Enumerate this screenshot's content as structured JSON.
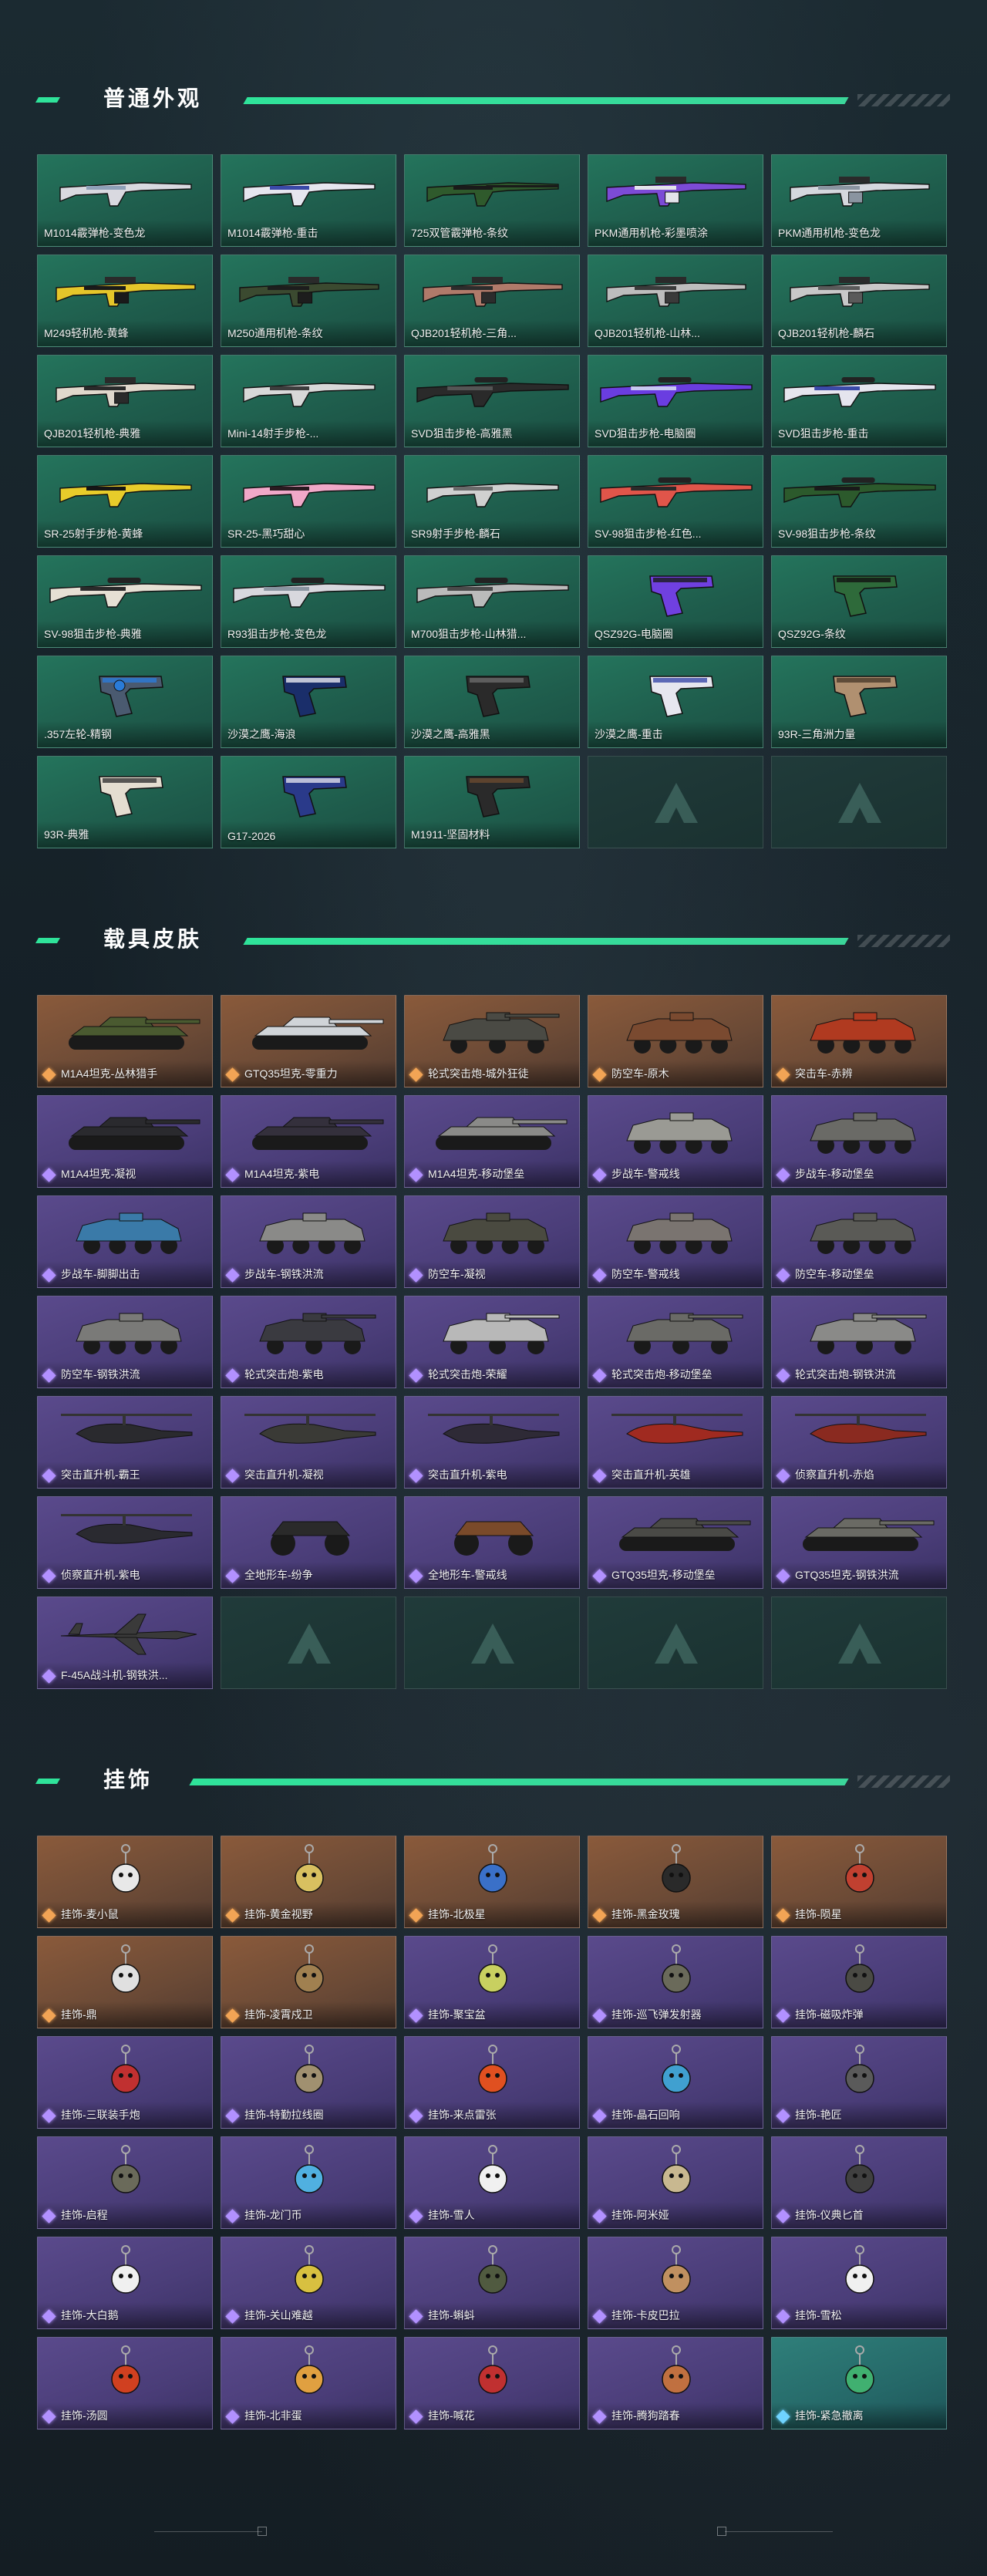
{
  "sections": [
    {
      "title": "普通外观"
    },
    {
      "title": "载具皮肤"
    },
    {
      "title": "挂饰"
    }
  ],
  "weapons": [
    {
      "label": "M1014霰弹枪-变色龙",
      "kind": "shotgun",
      "color": "#d9d9e0",
      "accent": "#8fa0b8"
    },
    {
      "label": "M1014霰弹枪-重击",
      "kind": "shotgun",
      "color": "#e6e6ef",
      "accent": "#3a49a8"
    },
    {
      "label": "725双管霰弹枪-条纹",
      "kind": "double",
      "color": "#2f5a2c",
      "accent": "#1a1a1a"
    },
    {
      "label": "PKM通用机枪-彩墨喷涂",
      "kind": "mg",
      "color": "#7c4bd6",
      "accent": "#e3e3ea"
    },
    {
      "label": "PKM通用机枪-变色龙",
      "kind": "mg",
      "color": "#d5d8de",
      "accent": "#8a94a0"
    },
    {
      "label": "M249轻机枪-黄蜂",
      "kind": "mg",
      "color": "#e5c62a",
      "accent": "#1a1a1a"
    },
    {
      "label": "M250通用机枪-条纹",
      "kind": "mg",
      "color": "#3b4a30",
      "accent": "#1d1d1d"
    },
    {
      "label": "QJB201轻机枪-三角...",
      "kind": "mg",
      "color": "#b07a6a",
      "accent": "#2c2c2c"
    },
    {
      "label": "QJB201轻机枪-山林...",
      "kind": "mg",
      "color": "#bdbdbd",
      "accent": "#3a3a3a"
    },
    {
      "label": "QJB201轻机枪-麟石",
      "kind": "mg",
      "color": "#c8c8c8",
      "accent": "#5a5a5a"
    },
    {
      "label": "QJB201轻机枪-典雅",
      "kind": "mg",
      "color": "#e0d8cc",
      "accent": "#2a2a2a"
    },
    {
      "label": "Mini-14射手步枪-...",
      "kind": "rifle",
      "color": "#d8d8d8",
      "accent": "#3d3d3d"
    },
    {
      "label": "SVD狙击步枪-高雅黑",
      "kind": "sniper",
      "color": "#2a2a2a",
      "accent": "#555"
    },
    {
      "label": "SVD狙击步枪-电脑圈",
      "kind": "sniper",
      "color": "#6a3de0",
      "accent": "#c8c8f0"
    },
    {
      "label": "SVD狙击步枪-重击",
      "kind": "sniper",
      "color": "#e5e5ee",
      "accent": "#3b4aa8"
    },
    {
      "label": "SR-25射手步枪-黄蜂",
      "kind": "rifle",
      "color": "#e8cc2a",
      "accent": "#151515"
    },
    {
      "label": "SR-25-黑巧甜心",
      "kind": "rifle",
      "color": "#f0a8c8",
      "accent": "#2a1a20"
    },
    {
      "label": "SR9射手步枪-麟石",
      "kind": "rifle",
      "color": "#d0d0d0",
      "accent": "#6a6a6a"
    },
    {
      "label": "SV-98狙击步枪-红色...",
      "kind": "sniper",
      "color": "#e0554a",
      "accent": "#2a2a2a"
    },
    {
      "label": "SV-98狙击步枪-条纹",
      "kind": "sniper",
      "color": "#2c5a2c",
      "accent": "#1a1a1a"
    },
    {
      "label": "SV-98狙击步枪-典雅",
      "kind": "sniper",
      "color": "#e6e0d4",
      "accent": "#2a2a2a"
    },
    {
      "label": "R93狙击步枪-变色龙",
      "kind": "sniper",
      "color": "#d8d8de",
      "accent": "#8a94a0"
    },
    {
      "label": "M700狙击步枪-山林猎...",
      "kind": "sniper",
      "color": "#bbbbbb",
      "accent": "#4a4a4a"
    },
    {
      "label": "QSZ92G-电脑圈",
      "kind": "pistol",
      "color": "#7040e0",
      "accent": "#1a1a1a"
    },
    {
      "label": "QSZ92G-条纹",
      "kind": "pistol",
      "color": "#2e6a3a",
      "accent": "#111"
    },
    {
      "label": ".357左轮-精钢",
      "kind": "revolver",
      "color": "#4a5a70",
      "accent": "#2a7bd8"
    },
    {
      "label": "沙漠之鹰-海浪",
      "kind": "pistol",
      "color": "#1a2e6a",
      "accent": "#e8e8f0"
    },
    {
      "label": "沙漠之鹰-高雅黑",
      "kind": "pistol",
      "color": "#2a2a2a",
      "accent": "#6a6a6a"
    },
    {
      "label": "沙漠之鹰-重击",
      "kind": "pistol",
      "color": "#e6e6ef",
      "accent": "#3a49a8"
    },
    {
      "label": "93R-三角洲力量",
      "kind": "pistol",
      "color": "#b09070",
      "accent": "#4a3a2a"
    },
    {
      "label": "93R-典雅",
      "kind": "pistol",
      "color": "#e4ddd0",
      "accent": "#333"
    },
    {
      "label": "G17-2026",
      "kind": "pistol",
      "color": "#2a3a8a",
      "accent": "#e0e0ea"
    },
    {
      "label": "M1911-坚固材料",
      "kind": "pistol",
      "color": "#2a2a2a",
      "accent": "#6a4a30"
    },
    {
      "label": "",
      "kind": "empty"
    },
    {
      "label": "",
      "kind": "empty"
    }
  ],
  "vehicles": [
    {
      "label": "M1A4坦克-丛林猎手",
      "tier": "orange",
      "kind": "tank",
      "color": "#4a5a30"
    },
    {
      "label": "GTQ35坦克-零重力",
      "tier": "orange",
      "kind": "tank",
      "color": "#d0d4d8"
    },
    {
      "label": "轮式突击炮-城外狂徒",
      "tier": "orange",
      "kind": "wheeled",
      "color": "#4a4a44"
    },
    {
      "label": "防空车-原木",
      "tier": "orange",
      "kind": "apc",
      "color": "#7a4a30"
    },
    {
      "label": "突击车-赤辨",
      "tier": "orange",
      "kind": "apc",
      "color": "#b03a20"
    },
    {
      "label": "M1A4坦克-凝视",
      "tier": "purple",
      "kind": "tank",
      "color": "#2a2a2e"
    },
    {
      "label": "M1A4坦克-紫电",
      "tier": "purple",
      "kind": "tank",
      "color": "#34303c"
    },
    {
      "label": "M1A4坦克-移动堡垒",
      "tier": "purple",
      "kind": "tank",
      "color": "#8a8a88"
    },
    {
      "label": "步战车-警戒线",
      "tier": "purple",
      "kind": "apc",
      "color": "#9a9a94"
    },
    {
      "label": "步战车-移动堡垒",
      "tier": "purple",
      "kind": "apc",
      "color": "#6a6a66"
    },
    {
      "label": "步战车-脚脚出击",
      "tier": "purple",
      "kind": "apc",
      "color": "#3a7aa8"
    },
    {
      "label": "步战车-钢铁洪流",
      "tier": "purple",
      "kind": "apc",
      "color": "#8a8a88"
    },
    {
      "label": "防空车-凝视",
      "tier": "purple",
      "kind": "apc",
      "color": "#4a4a40"
    },
    {
      "label": "防空车-警戒线",
      "tier": "purple",
      "kind": "apc",
      "color": "#7a7470"
    },
    {
      "label": "防空车-移动堡垒",
      "tier": "purple",
      "kind": "apc",
      "color": "#5a5a56"
    },
    {
      "label": "防空车-钢铁洪流",
      "tier": "purple",
      "kind": "apc",
      "color": "#7a7a78"
    },
    {
      "label": "轮式突击炮-紫电",
      "tier": "purple",
      "kind": "wheeled",
      "color": "#3a3a40"
    },
    {
      "label": "轮式突击炮-荣耀",
      "tier": "purple",
      "kind": "wheeled",
      "color": "#b8b8b8"
    },
    {
      "label": "轮式突击炮-移动堡垒",
      "tier": "purple",
      "kind": "wheeled",
      "color": "#6a6a66"
    },
    {
      "label": "轮式突击炮-钢铁洪流",
      "tier": "purple",
      "kind": "wheeled",
      "color": "#8a8a88"
    },
    {
      "label": "突击直升机-霸王",
      "tier": "purple",
      "kind": "heli",
      "color": "#2a2a2e"
    },
    {
      "label": "突击直升机-凝视",
      "tier": "purple",
      "kind": "heli",
      "color": "#3a3a36"
    },
    {
      "label": "突击直升机-紫电",
      "tier": "purple",
      "kind": "heli",
      "color": "#2e2a36"
    },
    {
      "label": "突击直升机-英雄",
      "tier": "purple",
      "kind": "heli",
      "color": "#a02a20"
    },
    {
      "label": "侦察直升机-赤焰",
      "tier": "purple",
      "kind": "heli",
      "color": "#8a2a20"
    },
    {
      "label": "侦察直升机-紫电",
      "tier": "purple",
      "kind": "heli",
      "color": "#2a2a30"
    },
    {
      "label": "全地形车-纷争",
      "tier": "purple",
      "kind": "atv",
      "color": "#2a2a2a"
    },
    {
      "label": "全地形车-警戒线",
      "tier": "purple",
      "kind": "atv",
      "color": "#7a4a2a"
    },
    {
      "label": "GTQ35坦克-移动堡垒",
      "tier": "purple",
      "kind": "tank",
      "color": "#4a4a46"
    },
    {
      "label": "GTQ35坦克-钢铁洪流",
      "tier": "purple",
      "kind": "tank",
      "color": "#6a6a64"
    },
    {
      "label": "F-45A战斗机-钢铁洪...",
      "tier": "purple",
      "kind": "jet",
      "color": "#3a3a3a"
    },
    {
      "label": "",
      "tier": "empty",
      "kind": "empty"
    },
    {
      "label": "",
      "tier": "empty",
      "kind": "empty"
    },
    {
      "label": "",
      "tier": "empty",
      "kind": "empty"
    },
    {
      "label": "",
      "tier": "empty",
      "kind": "empty"
    }
  ],
  "charms": [
    {
      "label": "挂饰-麦小鼠",
      "tier": "orange",
      "color": "#e8e8e8"
    },
    {
      "label": "挂饰-黄金视野",
      "tier": "orange",
      "color": "#d8c060"
    },
    {
      "label": "挂饰-北极星",
      "tier": "orange",
      "color": "#3a70c8"
    },
    {
      "label": "挂饰-黑金玫瑰",
      "tier": "orange",
      "color": "#2a2a2a"
    },
    {
      "label": "挂饰-陨星",
      "tier": "orange",
      "color": "#c04030"
    },
    {
      "label": "挂饰-鼎",
      "tier": "orange",
      "color": "#e0e0e0"
    },
    {
      "label": "挂饰-凌霄戍卫",
      "tier": "orange",
      "color": "#a08050"
    },
    {
      "label": "挂饰-聚宝盆",
      "tier": "purple",
      "color": "#c8d060"
    },
    {
      "label": "挂饰-巡飞弹发射器",
      "tier": "purple",
      "color": "#6a6a5a"
    },
    {
      "label": "挂饰-磁吸炸弹",
      "tier": "purple",
      "color": "#4a4a44"
    },
    {
      "label": "挂饰-三联装手炮",
      "tier": "purple",
      "color": "#c03030"
    },
    {
      "label": "挂饰-特勤拉线圈",
      "tier": "purple",
      "color": "#a09070"
    },
    {
      "label": "挂饰-来点雷张",
      "tier": "purple",
      "color": "#e05020"
    },
    {
      "label": "挂饰-晶石回响",
      "tier": "purple",
      "color": "#40a0d0"
    },
    {
      "label": "挂饰-艳匠",
      "tier": "purple",
      "color": "#5a5a5a"
    },
    {
      "label": "挂饰-启程",
      "tier": "purple",
      "color": "#6a6a5a"
    },
    {
      "label": "挂饰-龙门币",
      "tier": "purple",
      "color": "#50b0e0"
    },
    {
      "label": "挂饰-雪人",
      "tier": "purple",
      "color": "#f0f0f0"
    },
    {
      "label": "挂饰-阿米娅",
      "tier": "purple",
      "color": "#c8b890"
    },
    {
      "label": "挂饰-仪典匕首",
      "tier": "purple",
      "color": "#404040"
    },
    {
      "label": "挂饰-大白鹅",
      "tier": "purple",
      "color": "#f0f0f0"
    },
    {
      "label": "挂饰-关山难越",
      "tier": "purple",
      "color": "#d8c040"
    },
    {
      "label": "挂饰-蝌蚪",
      "tier": "purple",
      "color": "#505a40"
    },
    {
      "label": "挂饰-卡皮巴拉",
      "tier": "purple",
      "color": "#c09060"
    },
    {
      "label": "挂饰-雪松",
      "tier": "purple",
      "color": "#f0f0f0"
    },
    {
      "label": "挂饰-汤圆",
      "tier": "purple",
      "color": "#d04020"
    },
    {
      "label": "挂饰-北非蛋",
      "tier": "purple",
      "color": "#e0a040"
    },
    {
      "label": "挂饰-喊花",
      "tier": "purple",
      "color": "#c03030"
    },
    {
      "label": "挂饰-腾狗踏春",
      "tier": "purple",
      "color": "#c07040"
    },
    {
      "label": "挂饰-紧急撤离",
      "tier": "blue",
      "color": "#40b070"
    }
  ]
}
